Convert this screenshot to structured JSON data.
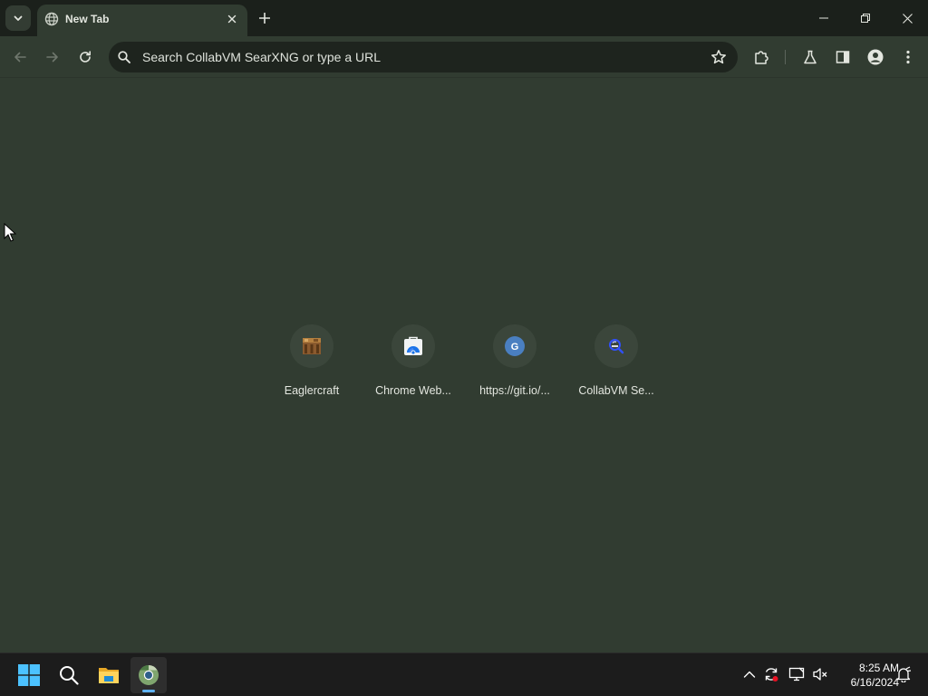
{
  "browser": {
    "tab": {
      "title": "New Tab",
      "favicon": "globe-icon"
    },
    "omnibox": {
      "placeholder": "Search CollabVM SearXNG or type a URL"
    }
  },
  "shortcuts": [
    {
      "title": "Eaglercraft",
      "icon": "crafting-table-icon"
    },
    {
      "title": "Chrome Web...",
      "icon": "chrome-web-store-icon"
    },
    {
      "title": "https://git.io/...",
      "icon": "letter-g-icon",
      "letter": "G"
    },
    {
      "title": "CollabVM Se...",
      "icon": "searxng-icon"
    }
  ],
  "taskbar": {
    "time": "8:25 AM",
    "date": "6/16/2024"
  },
  "colors": {
    "page_background": "#313c31",
    "tabstrip_background": "#1b201b",
    "omnibox_background": "#1e241e",
    "taskbar_background": "#1c1c1c",
    "taskbar_active_indicator": "#5fb2f2"
  }
}
